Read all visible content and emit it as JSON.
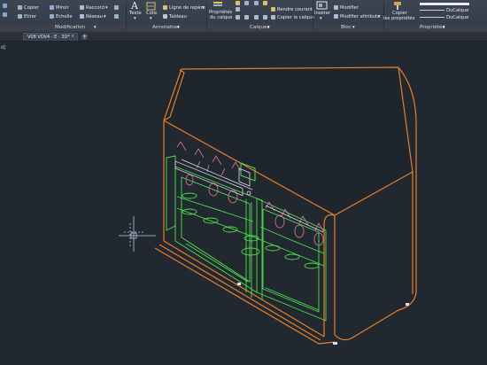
{
  "ribbon": {
    "modification": {
      "copier": "Copier",
      "miroir": "Miroir",
      "raccord": "Raccord",
      "etirer": "Etirer",
      "echelle": "Echelle",
      "reseau": "Réseau",
      "title": "Modification"
    },
    "annotation": {
      "texte": "Texte",
      "cote": "Cote",
      "ligne_repere": "Ligne de repère",
      "tableau": "Tableau",
      "title": "Annotation"
    },
    "calques": {
      "proprietes_line1": "Propriétés",
      "proprietes_line2": "du calque",
      "rendre_courant": "Rendre courant",
      "copier_calque": "Copier le calque",
      "title": "Calques"
    },
    "bloc": {
      "inserer": "Insérer",
      "modifier": "Modifier",
      "modifier_attributs": "Modifier attributs",
      "title": "Bloc"
    },
    "proprietes": {
      "copier_line1": "Copier",
      "copier_line2": "les propriétés",
      "ducalque_1": "DuCalque",
      "ducalque_2": "DuCalque",
      "title": "Propriétés"
    },
    "dropdown_arrow": "▾"
  },
  "tabs": {
    "document": "V08 VOV4 - E - 3D*",
    "close": "×",
    "new": "+"
  },
  "viewport": {
    "label": "d]"
  },
  "colors": {
    "background": "#212830",
    "ribbon": "#3a414d",
    "cabinet_outline": "#e87f2a",
    "interior_green": "#4ee04e",
    "magenta_parts": "#cf6f8a",
    "cursor": "#b9c7e0"
  }
}
